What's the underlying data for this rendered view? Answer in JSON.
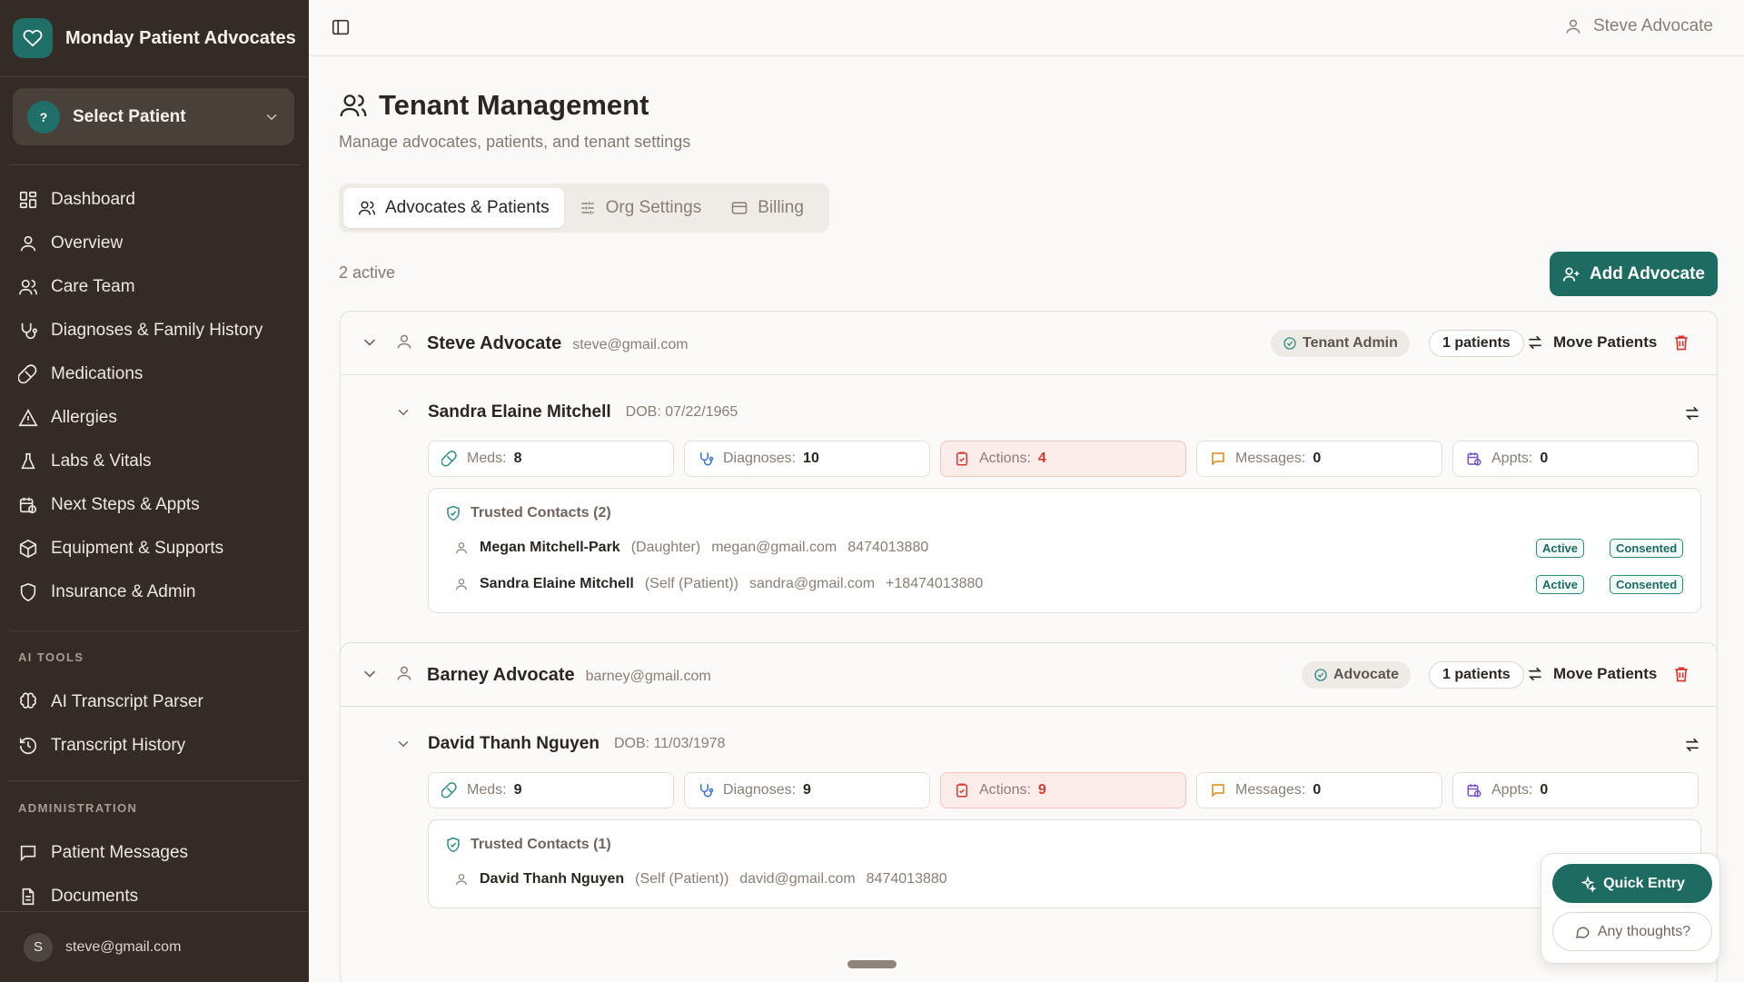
{
  "sidebar": {
    "brand": "Monday Patient Advocates",
    "patient_select": {
      "badge": "?",
      "label": "Select Patient"
    },
    "nav": [
      {
        "label": "Dashboard",
        "icon": "dashboard-icon"
      },
      {
        "label": "Overview",
        "icon": "user-icon"
      },
      {
        "label": "Care Team",
        "icon": "users-icon"
      },
      {
        "label": "Diagnoses & Family History",
        "icon": "stethoscope-icon"
      },
      {
        "label": "Medications",
        "icon": "pill-icon"
      },
      {
        "label": "Allergies",
        "icon": "warning-icon"
      },
      {
        "label": "Labs & Vitals",
        "icon": "flask-icon"
      },
      {
        "label": "Next Steps & Appts",
        "icon": "calendar-clock-icon"
      },
      {
        "label": "Equipment & Supports",
        "icon": "package-icon"
      },
      {
        "label": "Insurance & Admin",
        "icon": "shield-icon"
      }
    ],
    "ai_section": "AI TOOLS",
    "ai_nav": [
      {
        "label": "AI Transcript Parser",
        "icon": "brain-icon"
      },
      {
        "label": "Transcript History",
        "icon": "history-icon"
      }
    ],
    "admin_section": "ADMINISTRATION",
    "admin_nav": [
      {
        "label": "Patient Messages",
        "icon": "message-icon"
      },
      {
        "label": "Documents",
        "icon": "document-icon"
      }
    ],
    "user": {
      "initial": "S",
      "email": "steve@gmail.com"
    }
  },
  "topbar": {
    "user_name": "Steve Advocate"
  },
  "page": {
    "title": "Tenant Management",
    "subtitle": "Manage advocates, patients, and tenant settings",
    "tabs": [
      "Advocates & Patients",
      "Org Settings",
      "Billing"
    ],
    "active_count": "2 active",
    "add_button": "Add Advocate"
  },
  "advocates": [
    {
      "name": "Steve Advocate",
      "email": "steve@gmail.com",
      "role": "Tenant Admin",
      "patients_count": "1 patients",
      "move_label": "Move Patients",
      "patient": {
        "name": "Sandra Elaine Mitchell",
        "dob": "DOB: 07/22/1965",
        "stats": {
          "meds_label": "Meds:",
          "meds": "8",
          "diag_label": "Diagnoses:",
          "diag": "10",
          "actions_label": "Actions:",
          "actions": "4",
          "messages_label": "Messages:",
          "messages": "0",
          "appts_label": "Appts:",
          "appts": "0"
        },
        "tc_title": "Trusted Contacts (2)",
        "contacts": [
          {
            "name": "Megan Mitchell-Park",
            "relation": "(Daughter)",
            "email": "megan@gmail.com",
            "phone": "8474013880",
            "status": "Active",
            "consent": "Consented"
          },
          {
            "name": "Sandra Elaine Mitchell",
            "relation": "(Self (Patient))",
            "email": "sandra@gmail.com",
            "phone": "+18474013880",
            "status": "Active",
            "consent": "Consented"
          }
        ]
      }
    },
    {
      "name": "Barney Advocate",
      "email": "barney@gmail.com",
      "role": "Advocate",
      "patients_count": "1 patients",
      "move_label": "Move Patients",
      "patient": {
        "name": "David Thanh Nguyen",
        "dob": "DOB: 11/03/1978",
        "stats": {
          "meds_label": "Meds:",
          "meds": "9",
          "diag_label": "Diagnoses:",
          "diag": "9",
          "actions_label": "Actions:",
          "actions": "9",
          "messages_label": "Messages:",
          "messages": "0",
          "appts_label": "Appts:",
          "appts": "0"
        },
        "tc_title": "Trusted Contacts (1)",
        "contacts": [
          {
            "name": "David Thanh Nguyen",
            "relation": "(Self (Patient))",
            "email": "david@gmail.com",
            "phone": "8474013880"
          }
        ]
      }
    }
  ],
  "floating": {
    "quick_entry": "Quick Entry",
    "thoughts": "Any thoughts?"
  },
  "colors": {
    "accent": "#1e6b62",
    "sidebar_bg": "#342b26",
    "alert": "#d23a32"
  }
}
